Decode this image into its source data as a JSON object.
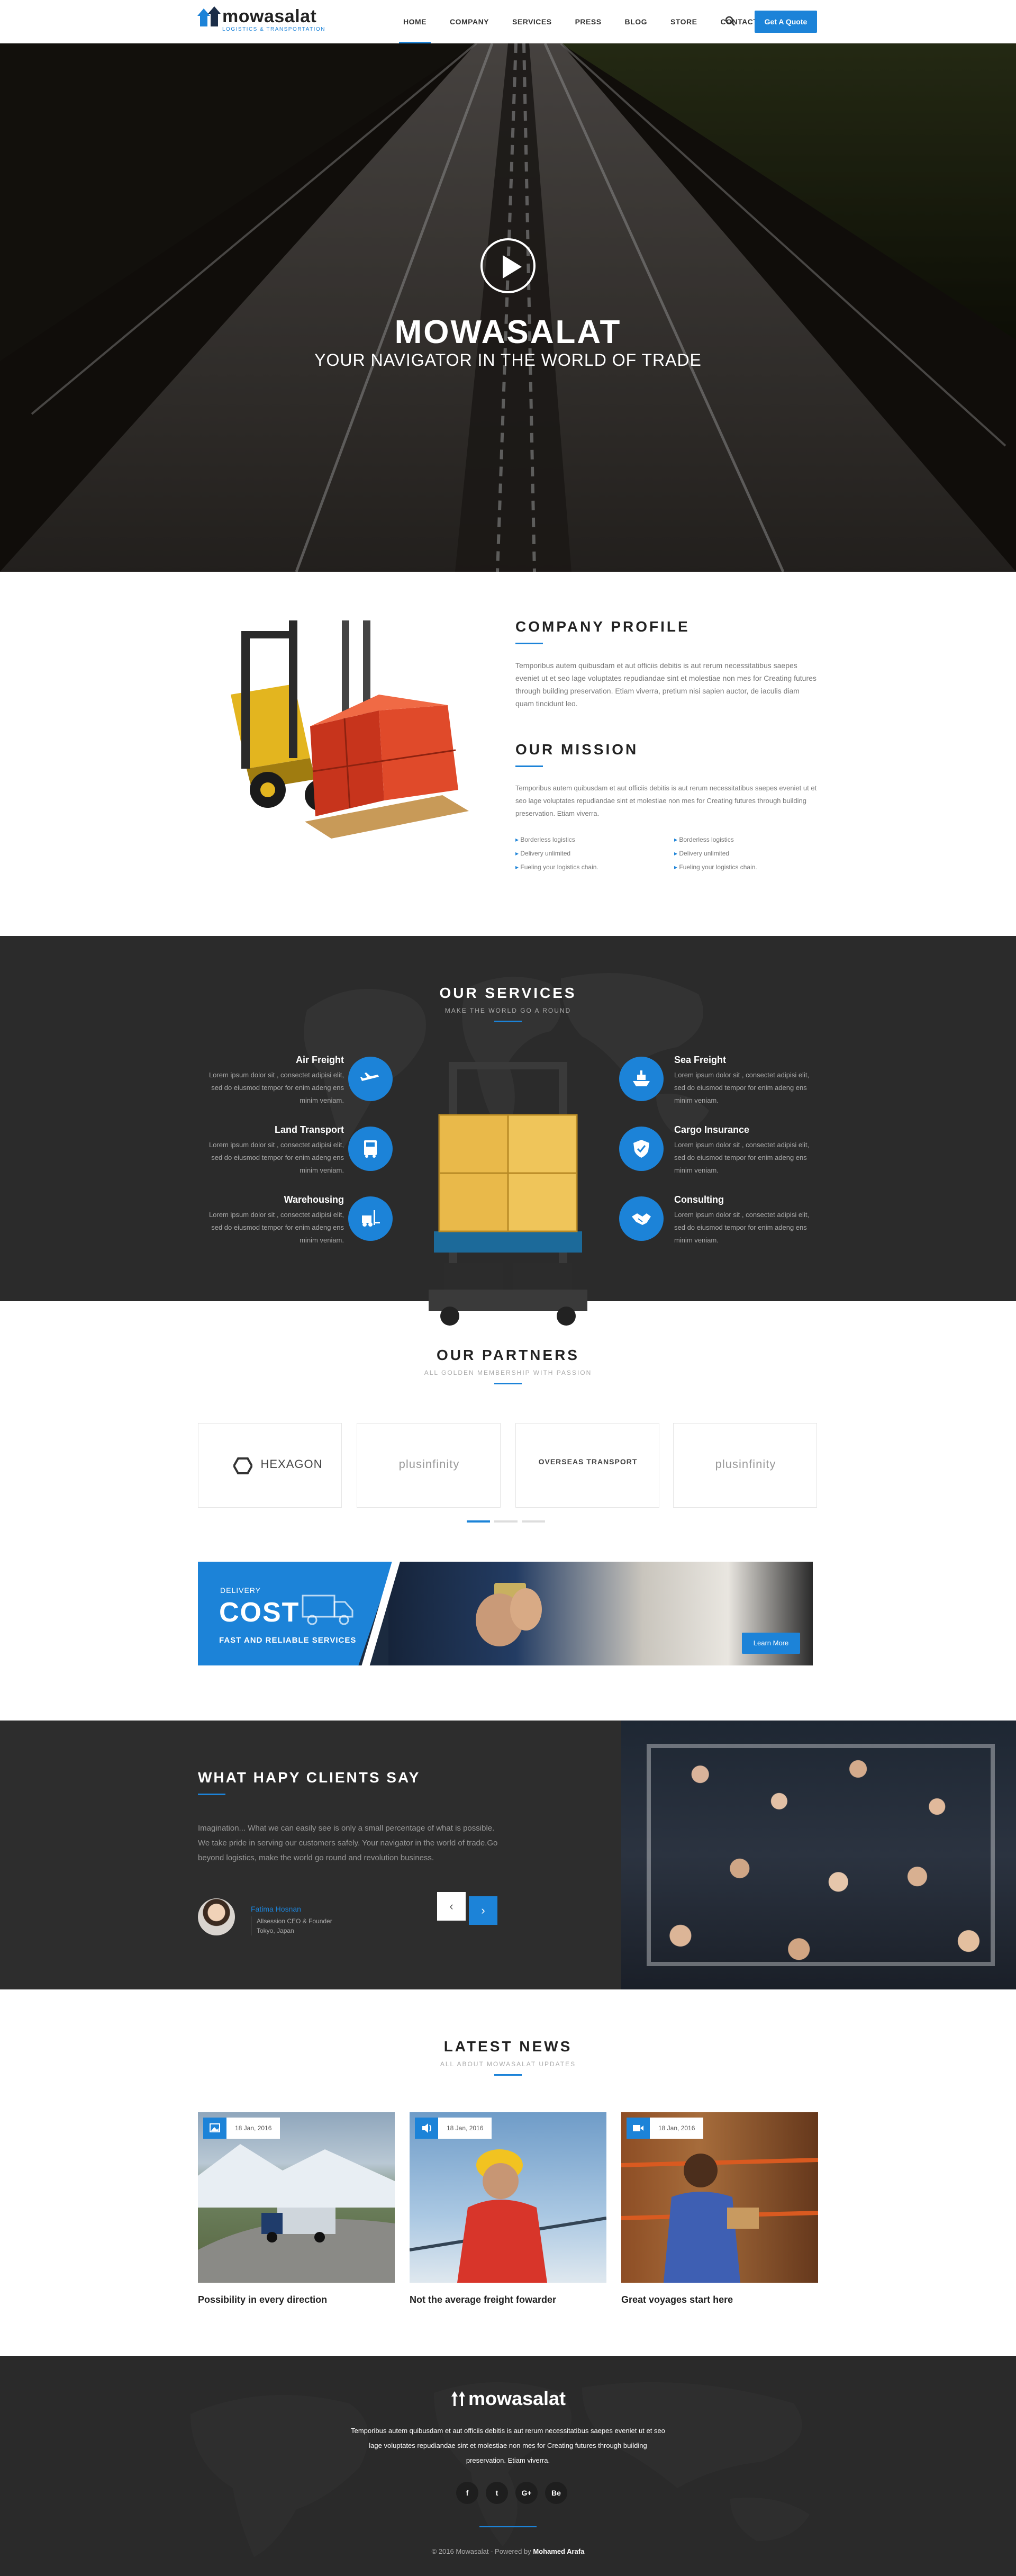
{
  "header": {
    "logo_text": "mowasalat",
    "logo_tagline": "LOGISTICS & TRANSPORTATION",
    "nav": [
      "HOME",
      "COMPANY",
      "SERVICES",
      "PRESS",
      "BLOG",
      "STORE",
      "CONTACT"
    ],
    "active_nav": "HOME",
    "cta": "Get A Quote",
    "icons": {
      "search": "search-icon"
    }
  },
  "hero": {
    "title": "MOWASALAT",
    "subtitle": "YOUR NAVIGATOR IN THE WORLD OF TRADE",
    "icon": "play-icon"
  },
  "about": {
    "profile_title": "COMPANY PROFILE",
    "profile_text": "Temporibus autem quibusdam et aut officiis debitis is aut rerum necessitatibus saepes eveniet ut et seo lage voluptates repudiandae sint et molestiae non mes for Creating futures through building preservation. Etiam viverra, pretium nisi sapien auctor, de iaculis diam quam tincidunt leo.",
    "mission_title": "OUR MISSION",
    "mission_text": "Temporibus autem quibusdam et aut officiis debitis is aut rerum necessitatibus saepes eveniet ut et seo lage voluptates repudiandae sint et molestiae non mes for Creating futures through building preservation. Etiam viverra.",
    "bullets": [
      "Borderless logistics",
      "Borderless logistics",
      "Delivery unlimited",
      "Delivery unlimited",
      "Fueling your logistics chain.",
      "Fueling your logistics chain."
    ]
  },
  "services": {
    "title": "OUR SERVICES",
    "subtitle": "MAKE THE WORLD GO A ROUND",
    "items": [
      {
        "name": "Air Freight",
        "desc": "Lorem ipsum dolor sit , consectet adipisi elit, sed do eiusmod tempor for enim adeng ens minim veniam.",
        "icon": "plane-icon"
      },
      {
        "name": "Land Transport",
        "desc": "Lorem ipsum dolor sit , consectet adipisi elit, sed do eiusmod tempor for enim adeng ens minim veniam.",
        "icon": "truck-icon"
      },
      {
        "name": "Warehousing",
        "desc": "Lorem ipsum dolor sit , consectet adipisi elit, sed do eiusmod tempor for enim adeng ens minim veniam.",
        "icon": "forklift-icon"
      },
      {
        "name": "Sea Freight",
        "desc": "Lorem ipsum dolor sit , consectet adipisi elit, sed do eiusmod tempor for enim adeng ens minim veniam.",
        "icon": "ship-icon"
      },
      {
        "name": "Cargo Insurance",
        "desc": "Lorem ipsum dolor sit , consectet adipisi elit, sed do eiusmod tempor for enim adeng ens minim veniam.",
        "icon": "shield-icon"
      },
      {
        "name": "Consulting",
        "desc": "Lorem ipsum dolor sit , consectet adipisi elit, sed do eiusmod tempor for enim adeng ens minim veniam.",
        "icon": "handshake-icon"
      }
    ]
  },
  "partners": {
    "title": "OUR PARTNERS",
    "subtitle": "ALL GOLDEN MEMBERSHIP WITH PASSION",
    "logos": [
      "HEXAGON",
      "plusinfinity",
      "OVERSEAS TRANSPORT",
      "plusinfinity"
    ],
    "active_slide": 1,
    "slide_count": 3
  },
  "banner": {
    "small": "DELIVERY",
    "big": "COST",
    "tagline": "FAST AND RELIABLE SERVICES",
    "button": "Learn More",
    "icon": "truck-icon"
  },
  "testimonials": {
    "title": "WHAT HAPY CLIENTS SAY",
    "quote": "Imagination... What we can easily see is only a small percentage of what is possible. We take pride in serving our customers safely. Your navigator in the world of trade.Go beyond logistics, make the world go round and revolution business.",
    "client_name": "Fatima Hosnan",
    "client_role": "Allsession CEO & Founder",
    "client_location": "Tokyo, Japan",
    "prev": "‹",
    "next": "›"
  },
  "news": {
    "title": "LATEST NEWS",
    "subtitle": "ALL ABOUT MOWASALAT UPDATES",
    "items": [
      {
        "date": "18 Jan, 2016",
        "title": "Possibility in every direction",
        "icon": "image-icon"
      },
      {
        "date": "18 Jan, 2016",
        "title": "Not the average freight fowarder",
        "icon": "audio-icon"
      },
      {
        "date": "18 Jan, 2016",
        "title": "Great voyages start here",
        "icon": "video-icon"
      }
    ]
  },
  "footer": {
    "logo": "mowasalat",
    "text": "Temporibus autem quibusdam et aut officiis debitis is aut rerum necessitatibus saepes eveniet ut et seo lage voluptates repudiandae sint et molestiae non mes for Creating futures through building preservation. Etiam viverra.",
    "socials": [
      "f",
      "t",
      "G+",
      "Be"
    ],
    "copyright_prefix": "© 2016 Mowasalat - Powered by",
    "copyright_author": "Mohamed Arafa"
  },
  "colors": {
    "accent": "#1c83d8",
    "dark": "#2b2b2b"
  }
}
